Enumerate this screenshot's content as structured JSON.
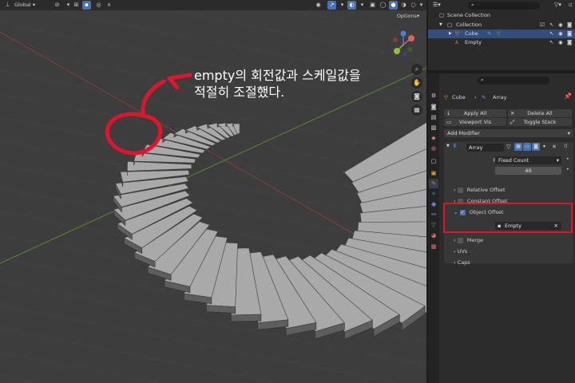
{
  "viewport": {
    "header": {
      "transform_orientation": "Global",
      "options_label": "Options"
    },
    "annotation": {
      "line1": "empty의 회전값과 스케일값을",
      "line2": "적절히 조절했다."
    },
    "stair_step_count": 40
  },
  "outliner": {
    "search_placeholder": "",
    "scene_collection": "Scene Collection",
    "collection": "Collection",
    "objects": [
      "Cube",
      "Empty"
    ]
  },
  "properties": {
    "search_placeholder": "",
    "breadcrumb": {
      "object": "Cube",
      "modifier": "Array"
    },
    "buttons": {
      "apply_all": "Apply All",
      "delete_all": "Delete All",
      "viewport_vis": "Viewport Vis",
      "toggle_stack": "Toggle Stack"
    },
    "add_modifier": "Add Modifier",
    "modifier": {
      "name": "Array",
      "fit_type_label": "Fit Type",
      "fit_type_value": "Fixed Count",
      "count_label": "Count",
      "count_value": "40",
      "relative_offset": "Relative Offset",
      "constant_offset": "Constant Offset",
      "object_offset": "Object Offset",
      "object_label": "Object",
      "object_value": "Empty",
      "merge": "Merge",
      "uvs": "UVs",
      "caps": "Caps"
    }
  },
  "colors": {
    "highlight_red": "#e0142a",
    "selection_blue": "#4772b3",
    "viewport_bg": "#3d3d3d"
  }
}
